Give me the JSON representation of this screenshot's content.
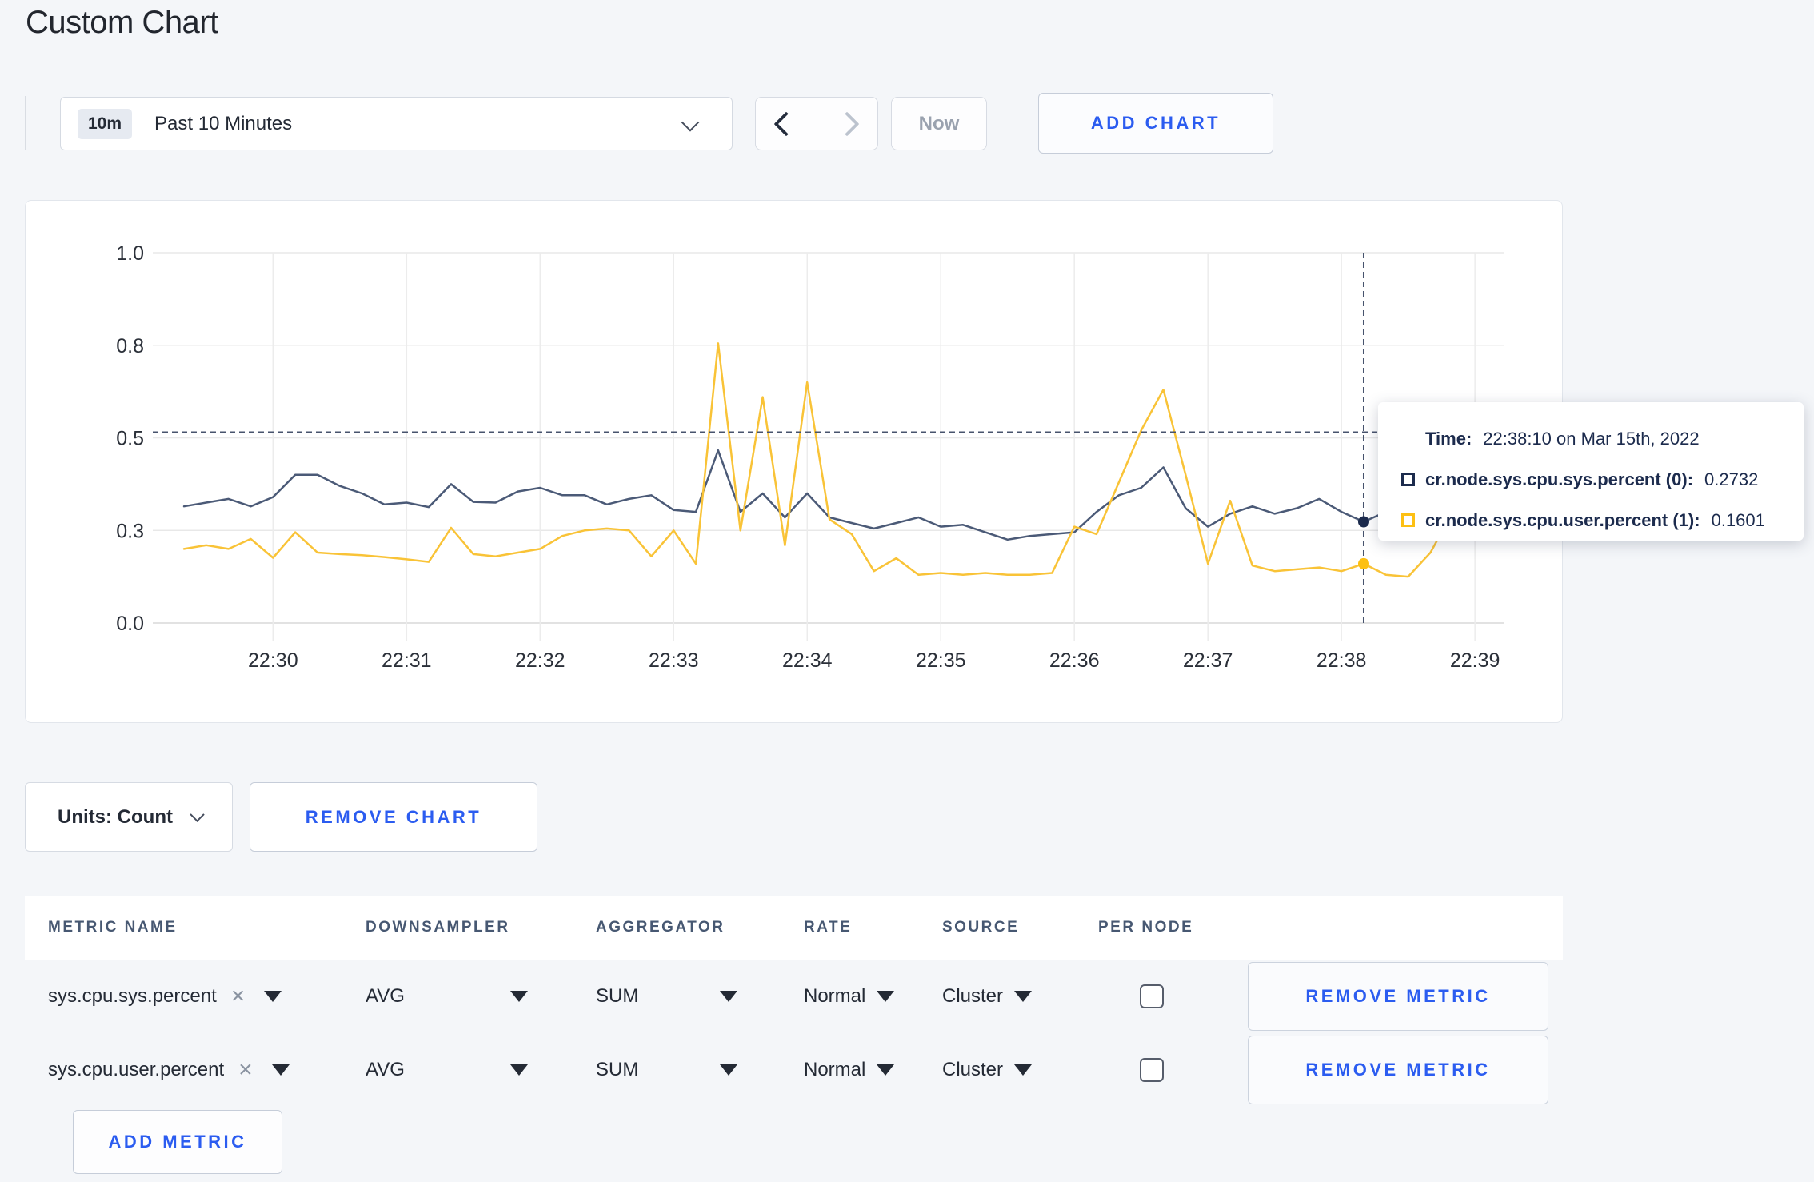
{
  "page": {
    "title": "Custom Chart"
  },
  "toolbar": {
    "time_range": {
      "badge": "10m",
      "label": "Past 10 Minutes"
    },
    "now_label": "Now",
    "add_chart_label": "ADD CHART"
  },
  "icons": {
    "time_dropdown": "chevron-down",
    "prev": "chevron-left",
    "next": "chevron-right",
    "select_caret": "triangle-down",
    "remove_metric_name": "x"
  },
  "chart_data": {
    "type": "line",
    "title": "",
    "xlabel": "",
    "ylabel": "",
    "ylim": [
      0.0,
      1.0
    ],
    "grid": true,
    "x": [
      "22:29:20",
      "22:29:30",
      "22:29:40",
      "22:29:50",
      "22:30:00",
      "22:30:10",
      "22:30:20",
      "22:30:30",
      "22:30:40",
      "22:30:50",
      "22:31:00",
      "22:31:10",
      "22:31:20",
      "22:31:30",
      "22:31:40",
      "22:31:50",
      "22:32:00",
      "22:32:10",
      "22:32:20",
      "22:32:30",
      "22:32:40",
      "22:32:50",
      "22:33:00",
      "22:33:10",
      "22:33:20",
      "22:33:30",
      "22:33:40",
      "22:33:50",
      "22:34:00",
      "22:34:10",
      "22:34:20",
      "22:34:30",
      "22:34:40",
      "22:34:50",
      "22:35:00",
      "22:35:10",
      "22:35:20",
      "22:35:30",
      "22:35:40",
      "22:35:50",
      "22:36:00",
      "22:36:10",
      "22:36:20",
      "22:36:30",
      "22:36:40",
      "22:36:50",
      "22:37:00",
      "22:37:10",
      "22:37:20",
      "22:37:30",
      "22:37:40",
      "22:37:50",
      "22:38:00",
      "22:38:10",
      "22:38:20",
      "22:38:30",
      "22:38:40",
      "22:38:50",
      "22:39:00"
    ],
    "x_tick_labels": [
      "22:30",
      "22:31",
      "22:32",
      "22:33",
      "22:34",
      "22:35",
      "22:36",
      "22:37",
      "22:38",
      "22:39"
    ],
    "y_ticks": [
      {
        "value": 0.0,
        "label": "0.0"
      },
      {
        "value": 0.25,
        "label": "0.3"
      },
      {
        "value": 0.5,
        "label": "0.5"
      },
      {
        "value": 0.75,
        "label": "0.8"
      },
      {
        "value": 1.0,
        "label": "1.0"
      }
    ],
    "series": [
      {
        "name": "cr.node.sys.cpu.sys.percent",
        "color": "#4b5a77",
        "values": [
          0.315,
          0.325,
          0.335,
          0.315,
          0.34,
          0.4,
          0.4,
          0.37,
          0.35,
          0.32,
          0.325,
          0.313,
          0.375,
          0.327,
          0.325,
          0.355,
          0.365,
          0.345,
          0.345,
          0.32,
          0.335,
          0.345,
          0.305,
          0.3,
          0.466,
          0.3,
          0.35,
          0.285,
          0.35,
          0.285,
          0.27,
          0.255,
          0.27,
          0.285,
          0.26,
          0.265,
          0.245,
          0.225,
          0.235,
          0.24,
          0.245,
          0.3,
          0.345,
          0.365,
          0.42,
          0.31,
          0.26,
          0.295,
          0.315,
          0.295,
          0.31,
          0.335,
          0.3,
          0.2732,
          0.3,
          0.31,
          0.3,
          0.3,
          0.305
        ]
      },
      {
        "name": "cr.node.sys.cpu.user.percent",
        "color": "#f9c337",
        "values": [
          0.2,
          0.21,
          0.2,
          0.227,
          0.176,
          0.245,
          0.19,
          0.186,
          0.183,
          0.178,
          0.172,
          0.165,
          0.257,
          0.186,
          0.18,
          0.19,
          0.2,
          0.235,
          0.25,
          0.255,
          0.25,
          0.18,
          0.25,
          0.16,
          0.755,
          0.25,
          0.61,
          0.21,
          0.65,
          0.28,
          0.24,
          0.14,
          0.175,
          0.13,
          0.135,
          0.13,
          0.135,
          0.13,
          0.13,
          0.135,
          0.26,
          0.24,
          0.38,
          0.52,
          0.63,
          0.4,
          0.16,
          0.33,
          0.155,
          0.14,
          0.145,
          0.15,
          0.14,
          0.1601,
          0.13,
          0.125,
          0.19,
          0.3,
          0.27
        ]
      }
    ],
    "crosshair": {
      "x_index": 53,
      "x_time": "22:38:10",
      "y_value": 0.515
    },
    "tooltip": {
      "time_label": "Time:",
      "time_value": "22:38:10 on Mar 15th, 2022",
      "rows": [
        {
          "label": "cr.node.sys.cpu.sys.percent (0):",
          "value": "0.2732",
          "color": "#1c2b4d"
        },
        {
          "label": "cr.node.sys.cpu.user.percent (1):",
          "value": "0.1601",
          "color": "#fdc013"
        }
      ]
    },
    "legend_position": "tooltip-only"
  },
  "controls": {
    "units_label": "Units: Count",
    "remove_chart_label": "REMOVE CHART"
  },
  "metrics_table": {
    "headers": [
      "METRIC NAME",
      "DOWNSAMPLER",
      "AGGREGATOR",
      "RATE",
      "SOURCE",
      "PER NODE"
    ],
    "rows": [
      {
        "name": "sys.cpu.sys.percent",
        "downsampler": "AVG",
        "aggregator": "SUM",
        "rate": "Normal",
        "source": "Cluster",
        "per_node_checked": false,
        "remove_label": "REMOVE METRIC"
      },
      {
        "name": "sys.cpu.user.percent",
        "downsampler": "AVG",
        "aggregator": "SUM",
        "rate": "Normal",
        "source": "Cluster",
        "per_node_checked": false,
        "remove_label": "REMOVE METRIC"
      }
    ],
    "add_metric_label": "ADD METRIC",
    "remove_icon": "×"
  }
}
